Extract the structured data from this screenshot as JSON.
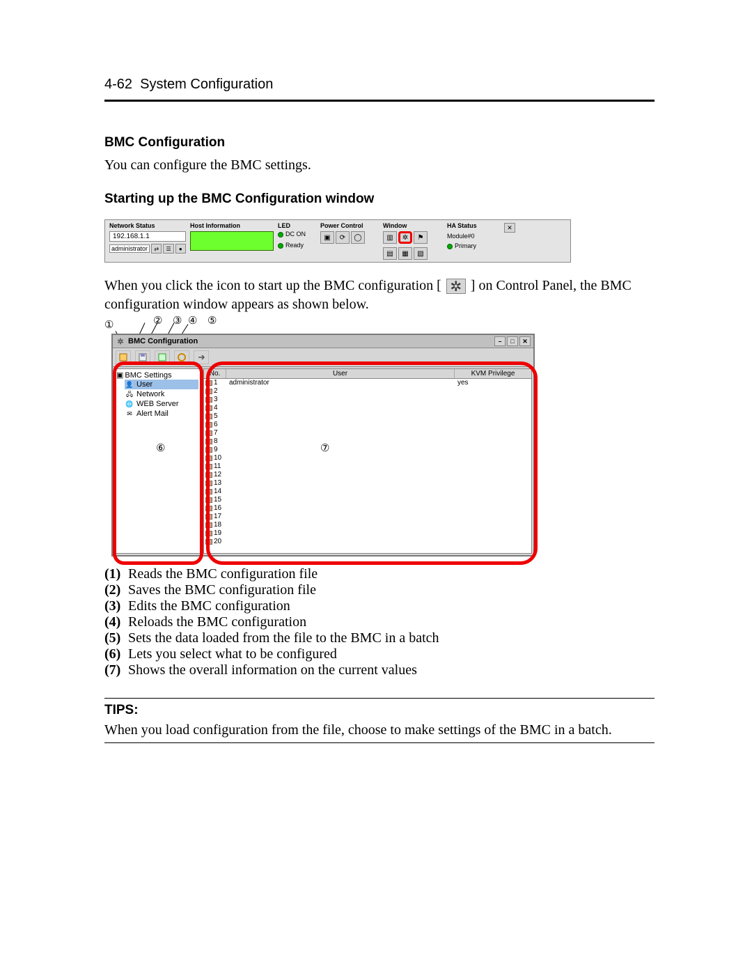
{
  "header": {
    "page_no": "4-62",
    "title": "System Configuration"
  },
  "section": {
    "bmc_config_h": "BMC Configuration",
    "bmc_config_p": "You can configure the BMC settings.",
    "starting_h": "Starting up the BMC Configuration window"
  },
  "control_panel": {
    "net_label": "Network Status",
    "ip": "192.168.1.1",
    "admin": "administrator",
    "host_label": "Host Information",
    "led_label": "LED",
    "dc_on": "DC ON",
    "ready": "Ready",
    "power_label": "Power Control",
    "window_label": "Window",
    "ha_label": "HA Status",
    "module": "Module#0",
    "primary": "Primary"
  },
  "para": {
    "p1a": "When you click the icon to start up the BMC configuration [",
    "p1b": "] on Control Panel, the BMC",
    "p2": "configuration window appears as shown below."
  },
  "callouts": {
    "c1": "①",
    "c2": "②",
    "c3": "③",
    "c4": "④",
    "c5": "⑤",
    "c6": "⑥",
    "c7": "⑦"
  },
  "bmc_window": {
    "title": "BMC Configuration",
    "tree_root": "BMC Settings",
    "tree": [
      "User",
      "Network",
      "WEB Server",
      "Alert Mail"
    ],
    "columns": {
      "no": "No.",
      "user": "User",
      "priv": "KVM Privilege"
    },
    "rows": [
      {
        "no": "1",
        "user": "administrator",
        "priv": "yes"
      },
      {
        "no": "2",
        "user": "",
        "priv": ""
      },
      {
        "no": "3",
        "user": "",
        "priv": ""
      },
      {
        "no": "4",
        "user": "",
        "priv": ""
      },
      {
        "no": "5",
        "user": "",
        "priv": ""
      },
      {
        "no": "6",
        "user": "",
        "priv": ""
      },
      {
        "no": "7",
        "user": "",
        "priv": ""
      },
      {
        "no": "8",
        "user": "",
        "priv": ""
      },
      {
        "no": "9",
        "user": "",
        "priv": ""
      },
      {
        "no": "10",
        "user": "",
        "priv": ""
      },
      {
        "no": "11",
        "user": "",
        "priv": ""
      },
      {
        "no": "12",
        "user": "",
        "priv": ""
      },
      {
        "no": "13",
        "user": "",
        "priv": ""
      },
      {
        "no": "14",
        "user": "",
        "priv": ""
      },
      {
        "no": "15",
        "user": "",
        "priv": ""
      },
      {
        "no": "16",
        "user": "",
        "priv": ""
      },
      {
        "no": "17",
        "user": "",
        "priv": ""
      },
      {
        "no": "18",
        "user": "",
        "priv": ""
      },
      {
        "no": "19",
        "user": "",
        "priv": ""
      },
      {
        "no": "20",
        "user": "",
        "priv": ""
      }
    ]
  },
  "legend": [
    {
      "n": "(1)",
      "t": "Reads the BMC configuration file"
    },
    {
      "n": "(2)",
      "t": "Saves the BMC configuration file"
    },
    {
      "n": "(3)",
      "t": "Edits the BMC configuration"
    },
    {
      "n": "(4)",
      "t": "Reloads the BMC configuration"
    },
    {
      "n": "(5)",
      "t": "Sets the data loaded from the file to the BMC in a batch"
    },
    {
      "n": "(6)",
      "t": "Lets you select what to be configured"
    },
    {
      "n": "(7)",
      "t": "Shows the overall information on the current values"
    }
  ],
  "tips": {
    "h": "TIPS:",
    "p": "When you load configuration from the file, choose to make settings of the BMC in a batch."
  }
}
